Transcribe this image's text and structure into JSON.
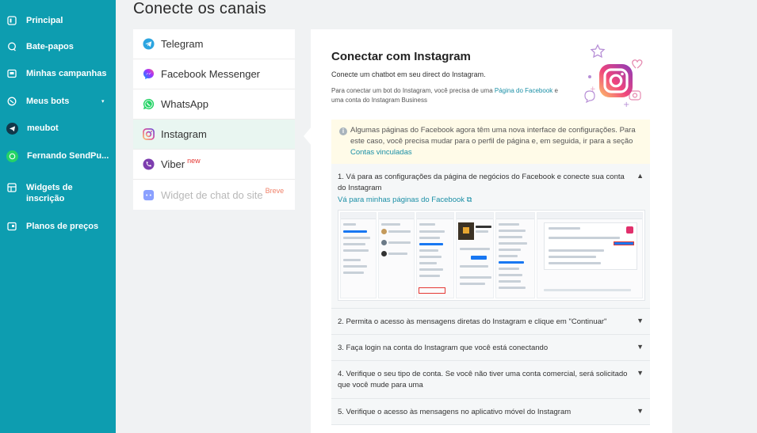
{
  "sidebar": {
    "items": [
      {
        "label": "Principal",
        "icon": "home-icon"
      },
      {
        "label": "Bate-papos",
        "icon": "chat-icon"
      },
      {
        "label": "Minhas campanhas",
        "icon": "campaign-icon"
      },
      {
        "label": "Meus bots",
        "icon": "bot-icon"
      },
      {
        "label": "meubot",
        "icon": "telegram-icon"
      },
      {
        "label": "Fernando SendPu...",
        "icon": "whatsapp-icon"
      },
      {
        "label": "Widgets de inscrição",
        "icon": "widget-icon"
      },
      {
        "label": "Planos de preços",
        "icon": "pricing-icon"
      }
    ],
    "caret": "▾"
  },
  "page": {
    "title": "Conecte os canais"
  },
  "channels": [
    {
      "label": "Telegram",
      "icon": "telegram-icon",
      "color": "#2ca5e0"
    },
    {
      "label": "Facebook Messenger",
      "icon": "messenger-icon",
      "color": "#7b4dff"
    },
    {
      "label": "WhatsApp",
      "icon": "whatsapp-icon",
      "color": "#25d366"
    },
    {
      "label": "Instagram",
      "icon": "instagram-icon",
      "color": "#e1306c"
    },
    {
      "label": "Viber",
      "badge": "new",
      "icon": "viber-icon",
      "color": "#7d3daf"
    },
    {
      "label": "Widget de chat do site",
      "badge": "Breve",
      "icon": "chat-widget-icon",
      "color": "#8aa0ff"
    }
  ],
  "panel": {
    "title": "Conectar com Instagram",
    "subtitle": "Conecte um chatbot em seu direct do Instagram.",
    "desc_prefix": "Para conectar um bot do Instagram, você precisa de uma ",
    "desc_link": "Página do Facebook",
    "desc_suffix": " e uma conta do Instagram Business",
    "info_text": "Algumas páginas do Facebook agora têm uma nova interface de configurações. Para este caso, você precisa mudar para o perfil de página e, em seguida, ir para a seção ",
    "info_link": "Contas vinculadas",
    "info_icon": "i"
  },
  "steps": [
    {
      "text": "1. Vá para as configurações da página de negócios do Facebook e conecte sua conta do Instagram",
      "link": "Vá para minhas páginas do Facebook ⧉",
      "expanded": true
    },
    {
      "text": "2. Permita o acesso às mensagens diretas do Instagram e clique em \"Continuar\""
    },
    {
      "text": "3. Faça login na conta do Instagram que você está conectando"
    },
    {
      "text": "4. Verifique o seu tipo de conta. Se você não tiver uma conta comercial, será solicitado que você mude para uma"
    },
    {
      "text": "5. Verifique o acesso às mensagens no aplicativo móvel do Instagram"
    }
  ],
  "chevrons": {
    "up": "▲",
    "down": "▼"
  },
  "colors": {
    "sidebar": "#0d9db0",
    "link": "#1a8fa6",
    "active": "#e9f6f1",
    "info_bg": "#fffbe8"
  }
}
